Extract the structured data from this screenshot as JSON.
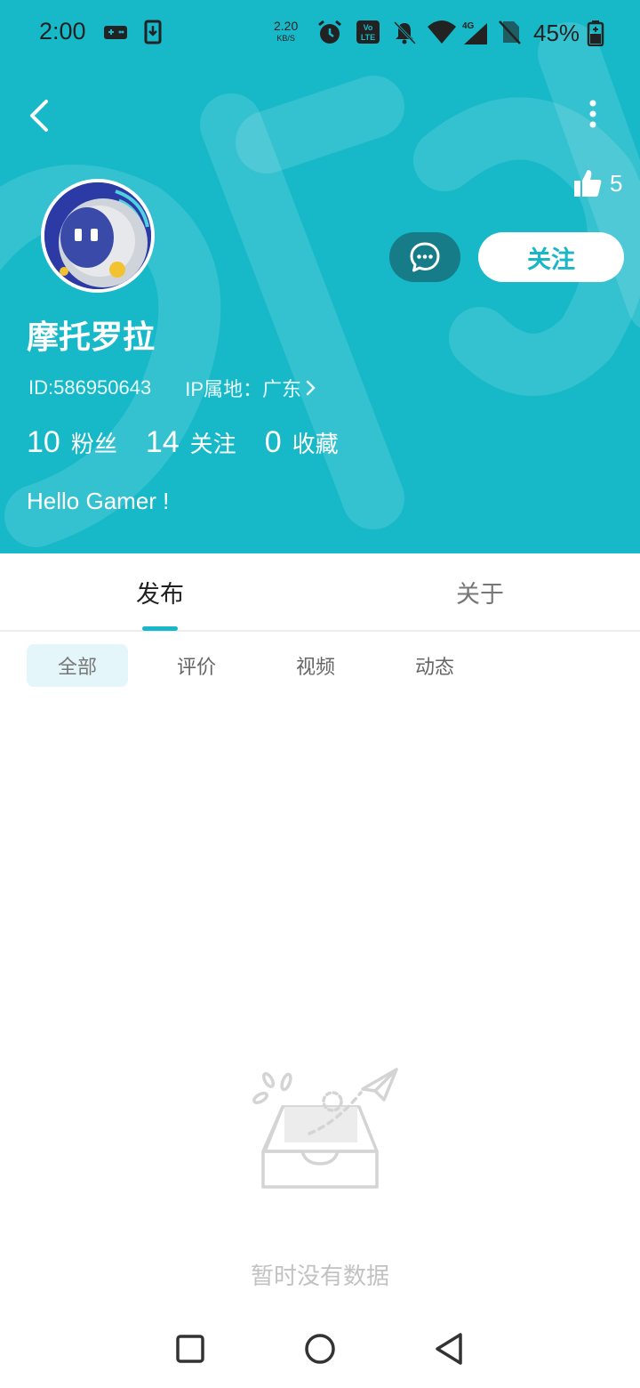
{
  "status_bar": {
    "time": "2:00",
    "net_speed": "2.20",
    "net_speed_unit": "KB/S",
    "volte": "Vo LTE",
    "signal_type": "4G",
    "battery": "45%"
  },
  "profile": {
    "likes": "5",
    "name": "摩托罗拉",
    "id": "ID:586950643",
    "ip_location": "IP属地：广东",
    "follow_label": "关注",
    "stats": [
      {
        "num": "10",
        "label": "粉丝"
      },
      {
        "num": "14",
        "label": "关注"
      },
      {
        "num": "0",
        "label": "收藏"
      }
    ],
    "bio": "Hello Gamer !"
  },
  "tabs": [
    {
      "label": "发布",
      "active": true
    },
    {
      "label": "关于",
      "active": false
    }
  ],
  "filters": [
    {
      "label": "全部",
      "active": true
    },
    {
      "label": "评价",
      "active": false
    },
    {
      "label": "视频",
      "active": false
    },
    {
      "label": "动态",
      "active": false
    }
  ],
  "empty_text": "暂时没有数据",
  "colors": {
    "brand": "#17b9c9",
    "message_button": "#157c88",
    "tab_indicator": "#17b9c9"
  },
  "icons": [
    "back-arrow-icon",
    "more-dots-icon",
    "thumbs-up-icon",
    "chat-bubble-icon",
    "chevron-right-icon",
    "square-nav-icon",
    "circle-nav-icon",
    "triangle-back-nav-icon"
  ]
}
